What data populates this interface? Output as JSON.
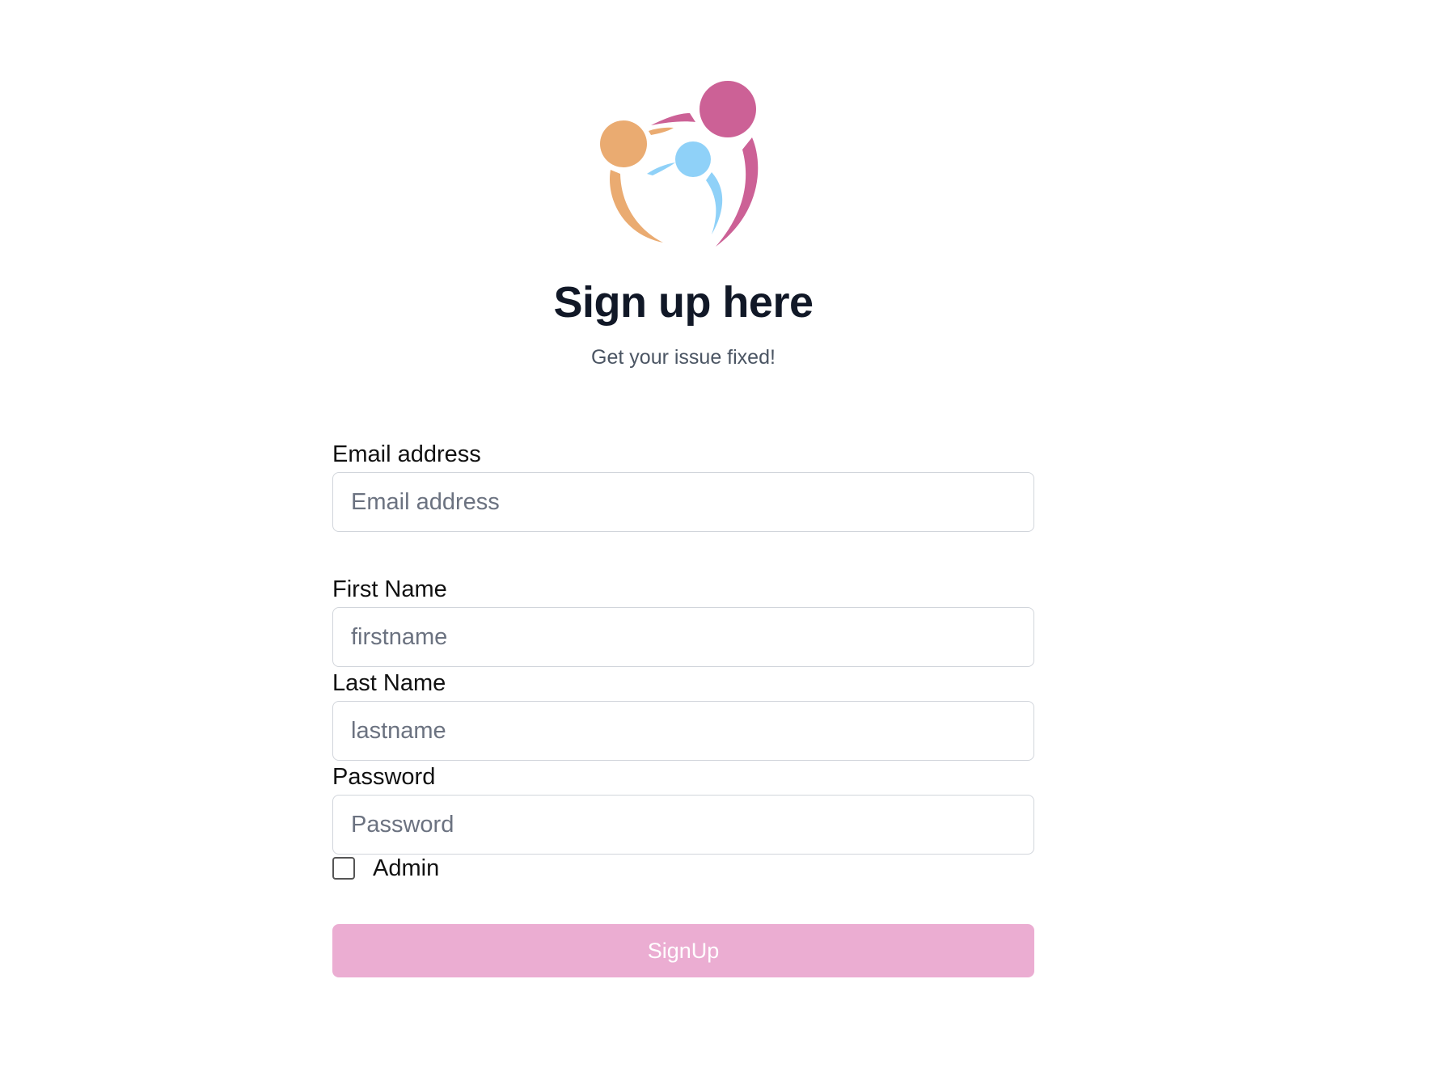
{
  "brand": {
    "logo_icon": "people-group-logo",
    "colors": {
      "pink": "#cc6196",
      "orange": "#eaab71",
      "blue": "#8fd1f8"
    }
  },
  "header": {
    "title": "Sign up here",
    "subtitle": "Get your issue fixed!"
  },
  "form": {
    "email": {
      "label": "Email address",
      "placeholder": "Email address",
      "value": ""
    },
    "first_name": {
      "label": "First Name",
      "placeholder": "firstname",
      "value": ""
    },
    "last_name": {
      "label": "Last Name",
      "placeholder": "lastname",
      "value": ""
    },
    "password": {
      "label": "Password",
      "placeholder": "Password",
      "value": ""
    },
    "admin": {
      "label": "Admin",
      "checked": false
    },
    "submit": {
      "label": "SignUp",
      "color": "#ebadd2"
    }
  }
}
